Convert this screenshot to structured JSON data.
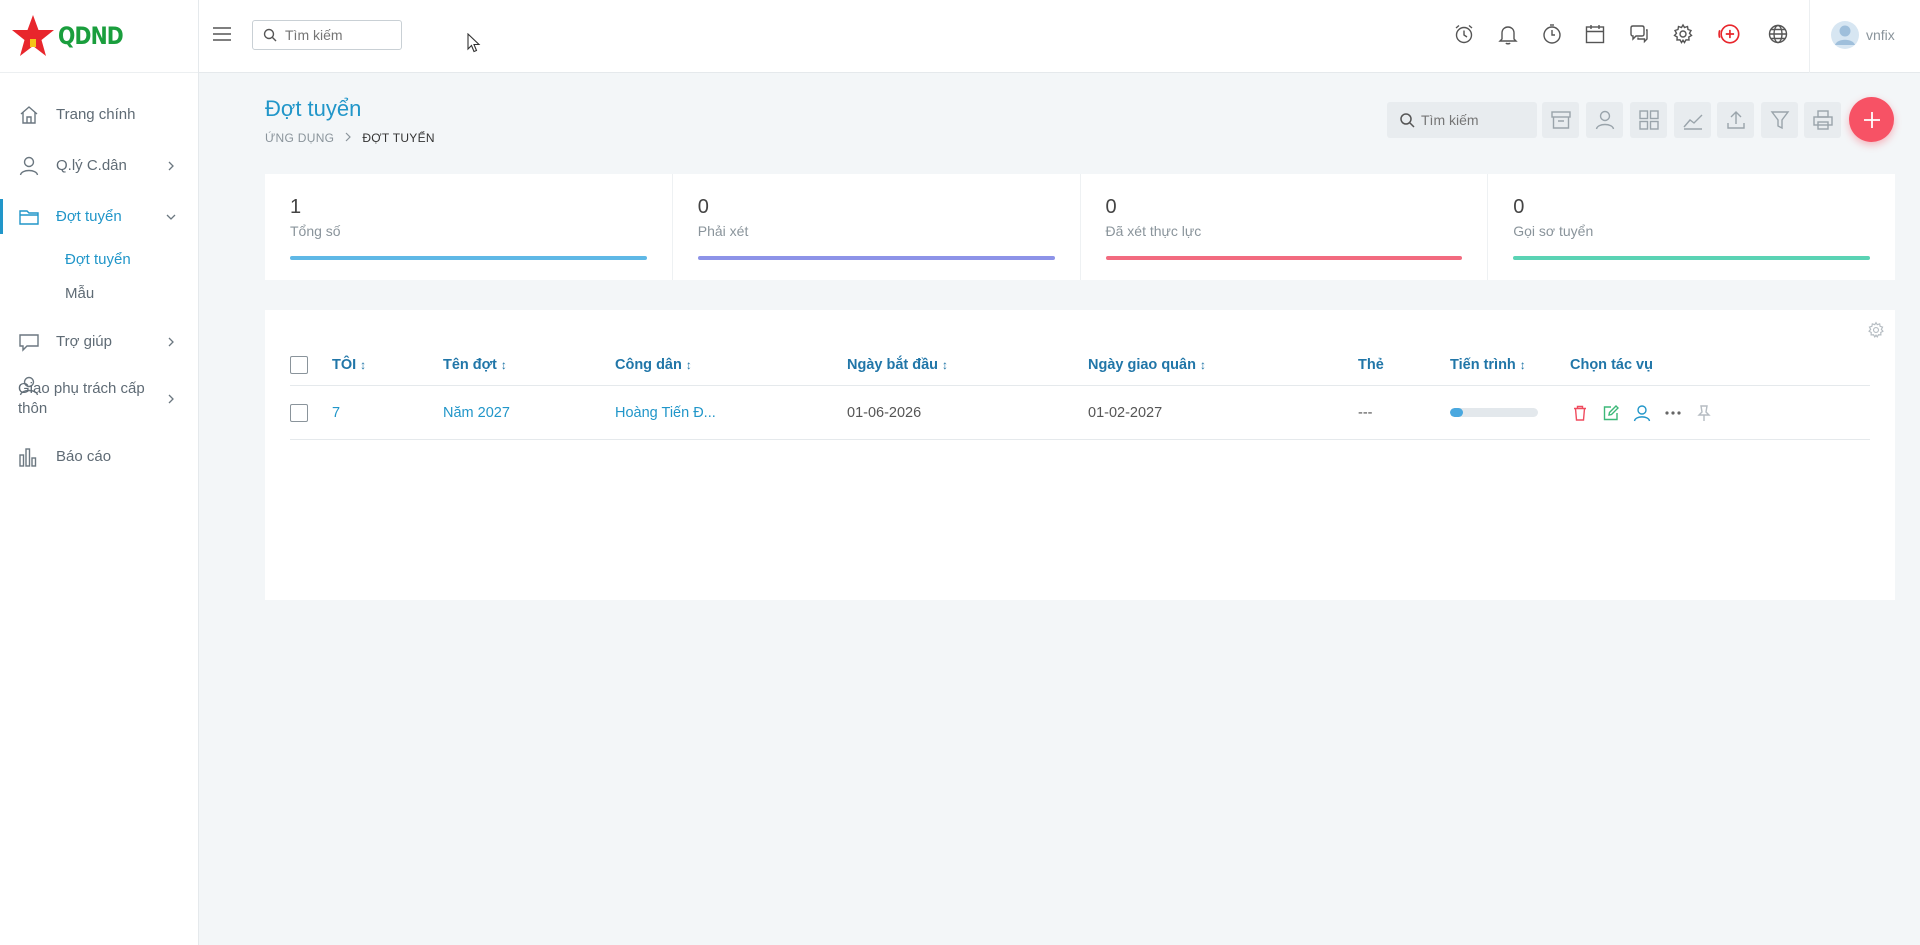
{
  "brand": {
    "logo_text": "QDND"
  },
  "topbar": {
    "search_placeholder": "Tìm kiếm",
    "user_name": "vnfix"
  },
  "sidebar": {
    "items": [
      {
        "label": "Trang chính",
        "icon": "home-icon"
      },
      {
        "label": "Q.lý C.dân",
        "icon": "user-icon"
      },
      {
        "label": "Đợt tuyển",
        "icon": "folder-icon"
      },
      {
        "label": "Trợ giúp",
        "icon": "chat-icon"
      },
      {
        "label": "Giao phụ trách cấp thôn",
        "icon": "user-icon"
      },
      {
        "label": "Báo cáo",
        "icon": "bar-chart-icon"
      }
    ],
    "sub_items": [
      {
        "label": "Đợt tuyển"
      },
      {
        "label": "Mẫu"
      }
    ]
  },
  "page": {
    "title": "Đợt tuyển",
    "breadcrumb": [
      "ỨNG DỤNG",
      "ĐỢT TUYỂN"
    ],
    "search_placeholder": "Tìm kiếm"
  },
  "stats": [
    {
      "value": "1",
      "label": "Tổng số",
      "color": "#5fb8e6"
    },
    {
      "value": "0",
      "label": "Phải xét",
      "color": "#8d93e8"
    },
    {
      "value": "0",
      "label": "Đã xét thực lực",
      "color": "#f26b7f"
    },
    {
      "value": "0",
      "label": "Gọi sơ tuyển",
      "color": "#5ad3b4"
    }
  ],
  "table": {
    "columns": [
      "TÔI",
      "Tên đợt",
      "Công dân",
      "Ngày bắt đầu",
      "Ngày giao quân",
      "Thẻ",
      "Tiến trình",
      "Chọn tác vụ"
    ],
    "sort_glyph": "↕",
    "rows": [
      {
        "id": "7",
        "name": "Năm 2027",
        "citizen": "Hoàng Tiến Đ...",
        "start": "01-06-2026",
        "handover": "01-02-2027",
        "tag": "---",
        "progress": 0.15
      }
    ]
  },
  "colors": {
    "accent": "#2196c9",
    "add": "#f75265",
    "brand_red": "#e8262c",
    "brand_green": "#1a9e3d"
  }
}
